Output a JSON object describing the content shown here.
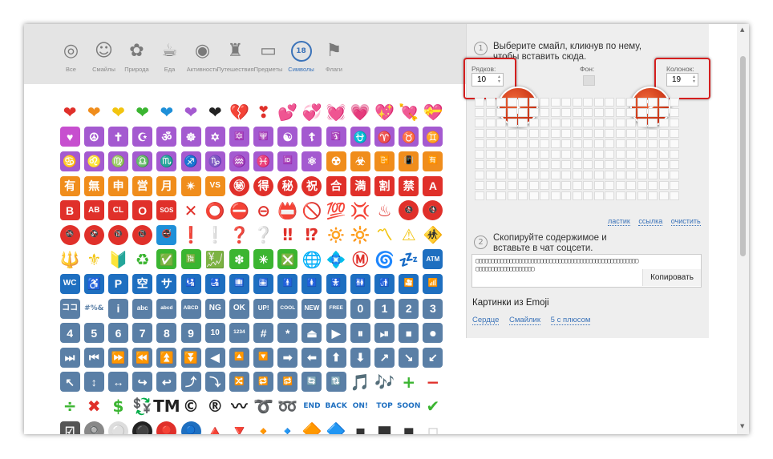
{
  "categories": [
    {
      "label": "Все",
      "icon": "spiral-icon",
      "glyph": "◎"
    },
    {
      "label": "Смайлы",
      "icon": "smiley-icon",
      "glyph": "☺"
    },
    {
      "label": "Природа",
      "icon": "monkey-icon",
      "glyph": "✿"
    },
    {
      "label": "Еда",
      "icon": "food-icon",
      "glyph": "☕"
    },
    {
      "label": "Активность",
      "icon": "target-icon",
      "glyph": "◉"
    },
    {
      "label": "Путешествия",
      "icon": "palace-icon",
      "glyph": "♜"
    },
    {
      "label": "Предметы",
      "icon": "monitor-icon",
      "glyph": "▭"
    },
    {
      "label": "Символы",
      "icon": "symbols-18-icon",
      "glyph": "18"
    },
    {
      "label": "Флаги",
      "icon": "flag-icon",
      "glyph": "⚑"
    }
  ],
  "emoji_grid": [
    {
      "t": "❤",
      "c": "#e0302a",
      "p": 1
    },
    {
      "t": "❤",
      "c": "#f08d1c",
      "p": 1
    },
    {
      "t": "❤",
      "c": "#f2c40f",
      "p": 1
    },
    {
      "t": "❤",
      "c": "#3bb531",
      "p": 1
    },
    {
      "t": "❤",
      "c": "#1e8fd8",
      "p": 1
    },
    {
      "t": "❤",
      "c": "#a45ad0",
      "p": 1
    },
    {
      "t": "❤",
      "c": "#222222",
      "p": 1
    },
    {
      "t": "💔",
      "c": "#d23a3a",
      "p": 1
    },
    {
      "t": "❣",
      "c": "#e0302a",
      "p": 1
    },
    {
      "t": "💕",
      "c": "#e94f9c",
      "p": 1
    },
    {
      "t": "💞",
      "c": "#e94f9c",
      "p": 1
    },
    {
      "t": "💓",
      "c": "#e94f9c",
      "p": 1
    },
    {
      "t": "💗",
      "c": "#e94f9c",
      "p": 1
    },
    {
      "t": "💖",
      "c": "#e94f9c",
      "p": 1
    },
    {
      "t": "💘",
      "c": "#e94f9c",
      "p": 1
    },
    {
      "t": "💝",
      "c": "#e94f9c",
      "p": 1
    },
    {
      "t": "♥",
      "c": "#c74fcf"
    },
    {
      "t": "☮",
      "c": "#a45ad0"
    },
    {
      "t": "✝",
      "c": "#a45ad0"
    },
    {
      "t": "☪",
      "c": "#a45ad0"
    },
    {
      "t": "ॐ",
      "c": "#a45ad0"
    },
    {
      "t": "☸",
      "c": "#a45ad0"
    },
    {
      "t": "✡",
      "c": "#a45ad0"
    },
    {
      "t": "🔯",
      "c": "#a45ad0"
    },
    {
      "t": "🕎",
      "c": "#a45ad0"
    },
    {
      "t": "☯",
      "c": "#a45ad0"
    },
    {
      "t": "☦",
      "c": "#a45ad0"
    },
    {
      "t": "🛐",
      "c": "#a45ad0"
    },
    {
      "t": "⛎",
      "c": "#a45ad0"
    },
    {
      "t": "♈",
      "c": "#a45ad0"
    },
    {
      "t": "♉",
      "c": "#a45ad0"
    },
    {
      "t": "♊",
      "c": "#a45ad0"
    },
    {
      "t": "♋",
      "c": "#a45ad0"
    },
    {
      "t": "♌",
      "c": "#a45ad0"
    },
    {
      "t": "♍",
      "c": "#a45ad0"
    },
    {
      "t": "♎",
      "c": "#a45ad0"
    },
    {
      "t": "♏",
      "c": "#a45ad0"
    },
    {
      "t": "♐",
      "c": "#a45ad0"
    },
    {
      "t": "♑",
      "c": "#a45ad0"
    },
    {
      "t": "♒",
      "c": "#a45ad0"
    },
    {
      "t": "♓",
      "c": "#a45ad0"
    },
    {
      "t": "🆔",
      "c": "#a45ad0"
    },
    {
      "t": "⚛",
      "c": "#a45ad0"
    },
    {
      "t": "☢",
      "c": "#f08d1c"
    },
    {
      "t": "☣",
      "c": "#f08d1c"
    },
    {
      "t": "📴",
      "c": "#f08d1c"
    },
    {
      "t": "📳",
      "c": "#f08d1c"
    },
    {
      "t": "🈶",
      "c": "#f08d1c"
    },
    {
      "t": "有",
      "c": "#f08d1c"
    },
    {
      "t": "無",
      "c": "#f08d1c"
    },
    {
      "t": "申",
      "c": "#f08d1c"
    },
    {
      "t": "営",
      "c": "#f08d1c"
    },
    {
      "t": "月",
      "c": "#f08d1c"
    },
    {
      "t": "✴",
      "c": "#f08d1c"
    },
    {
      "t": "VS",
      "c": "#f08d1c"
    },
    {
      "t": "㊙",
      "c": "#e0302a",
      "r": 1
    },
    {
      "t": "得",
      "c": "#e0302a",
      "r": 1
    },
    {
      "t": "秘",
      "c": "#e0302a",
      "r": 1
    },
    {
      "t": "祝",
      "c": "#e0302a",
      "r": 1
    },
    {
      "t": "合",
      "c": "#e0302a"
    },
    {
      "t": "満",
      "c": "#e0302a"
    },
    {
      "t": "割",
      "c": "#e0302a"
    },
    {
      "t": "禁",
      "c": "#e0302a"
    },
    {
      "t": "A",
      "c": "#e0302a"
    },
    {
      "t": "B",
      "c": "#e0302a"
    },
    {
      "t": "AB",
      "c": "#e0302a"
    },
    {
      "t": "CL",
      "c": "#e0302a"
    },
    {
      "t": "O",
      "c": "#e0302a"
    },
    {
      "t": "SOS",
      "c": "#e0302a"
    },
    {
      "t": "✕",
      "c": "#e0302a",
      "p": 1
    },
    {
      "t": "⭕",
      "c": "#e0302a",
      "p": 1
    },
    {
      "t": "⛔",
      "c": "#e0302a",
      "p": 1
    },
    {
      "t": "⊖",
      "c": "#e0302a",
      "p": 1
    },
    {
      "t": "📛",
      "c": "#e0302a",
      "p": 1
    },
    {
      "t": "🚫",
      "c": "#e0302a",
      "p": 1
    },
    {
      "t": "💯",
      "c": "#e0302a",
      "p": 1
    },
    {
      "t": "💢",
      "c": "#e0302a",
      "p": 1
    },
    {
      "t": "♨",
      "c": "#e0302a",
      "p": 1
    },
    {
      "t": "🚷",
      "c": "#e0302a",
      "r": 1
    },
    {
      "t": "🚯",
      "c": "#e0302a",
      "r": 1
    },
    {
      "t": "🚳",
      "c": "#e0302a",
      "r": 1
    },
    {
      "t": "🚱",
      "c": "#e0302a",
      "r": 1
    },
    {
      "t": "🔞",
      "c": "#e0302a",
      "r": 1
    },
    {
      "t": "📵",
      "c": "#e0302a",
      "r": 1
    },
    {
      "t": "🚭",
      "c": "#1e8fd8"
    },
    {
      "t": "❗",
      "c": "#e0302a",
      "p": 1
    },
    {
      "t": "❕",
      "c": "#bbbbbb",
      "p": 1
    },
    {
      "t": "❓",
      "c": "#e0302a",
      "p": 1
    },
    {
      "t": "❔",
      "c": "#bbbbbb",
      "p": 1
    },
    {
      "t": "‼",
      "c": "#e0302a",
      "p": 1
    },
    {
      "t": "⁉",
      "c": "#e0302a",
      "p": 1
    },
    {
      "t": "🔅",
      "c": "#f2c40f",
      "p": 1
    },
    {
      "t": "🔆",
      "c": "#f2c40f",
      "p": 1
    },
    {
      "t": "〽",
      "c": "#f2c40f",
      "p": 1
    },
    {
      "t": "⚠",
      "c": "#f2c40f",
      "p": 1
    },
    {
      "t": "🚸",
      "c": "#f2c40f",
      "p": 1
    },
    {
      "t": "🔱",
      "c": "#f2c40f",
      "p": 1
    },
    {
      "t": "⚜",
      "c": "#f2c40f",
      "p": 1
    },
    {
      "t": "🔰",
      "c": "#3bb531",
      "p": 1
    },
    {
      "t": "♻",
      "c": "#3bb531",
      "p": 1
    },
    {
      "t": "✅",
      "c": "#3bb531"
    },
    {
      "t": "🈯",
      "c": "#3bb531"
    },
    {
      "t": "💹",
      "c": "#3bb531",
      "p": 1
    },
    {
      "t": "❇",
      "c": "#3bb531"
    },
    {
      "t": "✳",
      "c": "#3bb531"
    },
    {
      "t": "❎",
      "c": "#3bb531"
    },
    {
      "t": "🌐",
      "c": "#1e8fd8",
      "p": 1
    },
    {
      "t": "💠",
      "c": "#1e8fd8",
      "p": 1
    },
    {
      "t": "Ⓜ",
      "c": "#e0302a",
      "p": 1
    },
    {
      "t": "🌀",
      "c": "#1e8fd8",
      "p": 1
    },
    {
      "t": "💤",
      "c": "#1e8fd8",
      "p": 1
    },
    {
      "t": "ATM",
      "c": "#1e6fc0"
    },
    {
      "t": "WC",
      "c": "#1e6fc0"
    },
    {
      "t": "♿",
      "c": "#1e6fc0"
    },
    {
      "t": "P",
      "c": "#1e6fc0"
    },
    {
      "t": "空",
      "c": "#1e6fc0"
    },
    {
      "t": "サ",
      "c": "#1e6fc0"
    },
    {
      "t": "🛂",
      "c": "#1e6fc0"
    },
    {
      "t": "🛃",
      "c": "#1e6fc0"
    },
    {
      "t": "🛄",
      "c": "#1e6fc0"
    },
    {
      "t": "🛅",
      "c": "#1e6fc0"
    },
    {
      "t": "🚹",
      "c": "#1e6fc0"
    },
    {
      "t": "🚺",
      "c": "#1e6fc0"
    },
    {
      "t": "🚼",
      "c": "#1e6fc0"
    },
    {
      "t": "🚻",
      "c": "#1e6fc0"
    },
    {
      "t": "🚮",
      "c": "#1e6fc0"
    },
    {
      "t": "🎦",
      "c": "#1e6fc0"
    },
    {
      "t": "📶",
      "c": "#1e6fc0"
    },
    {
      "t": "ココ",
      "c": "#5a7fa6"
    },
    {
      "t": "#%&",
      "c": "#5a7fa6",
      "p": 1
    },
    {
      "t": "i",
      "c": "#5a7fa6"
    },
    {
      "t": "abc",
      "c": "#5a7fa6"
    },
    {
      "t": "abcd",
      "c": "#5a7fa6"
    },
    {
      "t": "ABCD",
      "c": "#5a7fa6"
    },
    {
      "t": "NG",
      "c": "#5a7fa6"
    },
    {
      "t": "OK",
      "c": "#5a7fa6"
    },
    {
      "t": "UP!",
      "c": "#5a7fa6"
    },
    {
      "t": "COOL",
      "c": "#5a7fa6"
    },
    {
      "t": "NEW",
      "c": "#5a7fa6"
    },
    {
      "t": "FREE",
      "c": "#5a7fa6"
    },
    {
      "t": "0",
      "c": "#5a7fa6"
    },
    {
      "t": "1",
      "c": "#5a7fa6"
    },
    {
      "t": "2",
      "c": "#5a7fa6"
    },
    {
      "t": "3",
      "c": "#5a7fa6"
    },
    {
      "t": "4",
      "c": "#5a7fa6"
    },
    {
      "t": "5",
      "c": "#5a7fa6"
    },
    {
      "t": "6",
      "c": "#5a7fa6"
    },
    {
      "t": "7",
      "c": "#5a7fa6"
    },
    {
      "t": "8",
      "c": "#5a7fa6"
    },
    {
      "t": "9",
      "c": "#5a7fa6"
    },
    {
      "t": "10",
      "c": "#5a7fa6"
    },
    {
      "t": "1234",
      "c": "#5a7fa6"
    },
    {
      "t": "#",
      "c": "#5a7fa6"
    },
    {
      "t": "*",
      "c": "#5a7fa6"
    },
    {
      "t": "⏏",
      "c": "#5a7fa6"
    },
    {
      "t": "▶",
      "c": "#5a7fa6"
    },
    {
      "t": "⏸",
      "c": "#5a7fa6"
    },
    {
      "t": "⏯",
      "c": "#5a7fa6"
    },
    {
      "t": "⏹",
      "c": "#5a7fa6"
    },
    {
      "t": "⏺",
      "c": "#5a7fa6"
    },
    {
      "t": "⏭",
      "c": "#5a7fa6"
    },
    {
      "t": "⏮",
      "c": "#5a7fa6"
    },
    {
      "t": "⏩",
      "c": "#5a7fa6"
    },
    {
      "t": "⏪",
      "c": "#5a7fa6"
    },
    {
      "t": "⏫",
      "c": "#5a7fa6"
    },
    {
      "t": "⏬",
      "c": "#5a7fa6"
    },
    {
      "t": "◀",
      "c": "#5a7fa6"
    },
    {
      "t": "🔼",
      "c": "#5a7fa6"
    },
    {
      "t": "🔽",
      "c": "#5a7fa6"
    },
    {
      "t": "➡",
      "c": "#5a7fa6"
    },
    {
      "t": "⬅",
      "c": "#5a7fa6"
    },
    {
      "t": "⬆",
      "c": "#5a7fa6"
    },
    {
      "t": "⬇",
      "c": "#5a7fa6"
    },
    {
      "t": "↗",
      "c": "#5a7fa6"
    },
    {
      "t": "↘",
      "c": "#5a7fa6"
    },
    {
      "t": "↙",
      "c": "#5a7fa6"
    },
    {
      "t": "↖",
      "c": "#5a7fa6"
    },
    {
      "t": "↕",
      "c": "#5a7fa6"
    },
    {
      "t": "↔",
      "c": "#5a7fa6"
    },
    {
      "t": "↪",
      "c": "#5a7fa6"
    },
    {
      "t": "↩",
      "c": "#5a7fa6"
    },
    {
      "t": "⤴",
      "c": "#5a7fa6"
    },
    {
      "t": "⤵",
      "c": "#5a7fa6"
    },
    {
      "t": "🔀",
      "c": "#5a7fa6"
    },
    {
      "t": "🔁",
      "c": "#5a7fa6"
    },
    {
      "t": "🔂",
      "c": "#5a7fa6"
    },
    {
      "t": "🔄",
      "c": "#5a7fa6"
    },
    {
      "t": "🔃",
      "c": "#5a7fa6"
    },
    {
      "t": "🎵",
      "c": "#a45ad0",
      "p": 1
    },
    {
      "t": "🎶",
      "c": "#e0302a",
      "p": 1
    },
    {
      "t": "+",
      "c": "#3bb531",
      "p": 1
    },
    {
      "t": "−",
      "c": "#e0302a",
      "p": 1
    },
    {
      "t": "÷",
      "c": "#3bb531",
      "p": 1
    },
    {
      "t": "✖",
      "c": "#e0302a",
      "p": 1
    },
    {
      "t": "$",
      "c": "#3bb531",
      "p": 1
    },
    {
      "t": "💱",
      "c": "#3bb531",
      "p": 1
    },
    {
      "t": "TM",
      "c": "#222222",
      "p": 1
    },
    {
      "t": "©",
      "c": "#222222",
      "p": 1
    },
    {
      "t": "®",
      "c": "#222222",
      "p": 1
    },
    {
      "t": "〰",
      "c": "#222222",
      "p": 1
    },
    {
      "t": "➰",
      "c": "#1e8fd8",
      "p": 1
    },
    {
      "t": "➿",
      "c": "#1e8fd8",
      "p": 1
    },
    {
      "t": "END",
      "c": "#1e6fc0",
      "p": 1
    },
    {
      "t": "BACK",
      "c": "#1e6fc0",
      "p": 1
    },
    {
      "t": "ON!",
      "c": "#1e6fc0",
      "p": 1
    },
    {
      "t": "TOP",
      "c": "#1e6fc0",
      "p": 1
    },
    {
      "t": "SOON",
      "c": "#1e6fc0",
      "p": 1
    },
    {
      "t": "✔",
      "c": "#3bb531",
      "p": 1
    },
    {
      "t": "☑",
      "c": "#555555"
    },
    {
      "t": "🔘",
      "c": "#888888",
      "r": 1
    },
    {
      "t": "⚪",
      "c": "#dddddd",
      "r": 1
    },
    {
      "t": "⚫",
      "c": "#222222",
      "r": 1
    },
    {
      "t": "🔴",
      "c": "#e0302a",
      "r": 1
    },
    {
      "t": "🔵",
      "c": "#1e6fc0",
      "r": 1
    },
    {
      "t": "🔺",
      "c": "#e0302a",
      "p": 1
    },
    {
      "t": "🔻",
      "c": "#e0302a",
      "p": 1
    },
    {
      "t": "🔸",
      "c": "#f08d1c",
      "p": 1
    },
    {
      "t": "🔹",
      "c": "#1e8fd8",
      "p": 1
    },
    {
      "t": "🔶",
      "c": "#f08d1c",
      "p": 1
    },
    {
      "t": "🔷",
      "c": "#1e8fd8",
      "p": 1
    },
    {
      "t": "▪",
      "c": "#333333",
      "p": 1
    },
    {
      "t": "■",
      "c": "#333333",
      "p": 1
    },
    {
      "t": "◾",
      "c": "#333333",
      "p": 1
    },
    {
      "t": "◽",
      "c": "#cccccc",
      "p": 1
    }
  ],
  "step1": {
    "num": "1",
    "text": "Выберите смайл, кликнув по нему, чтобы вставить сюда."
  },
  "rows": {
    "label": "Рядков:",
    "value": "10"
  },
  "bg": {
    "label": "Фон:"
  },
  "cols": {
    "label": "Колонок:",
    "value": "19"
  },
  "badges": [
    "1",
    "2"
  ],
  "grid_links": [
    "ластик",
    "ссылка",
    "очистить"
  ],
  "step2": {
    "num": "2",
    "text": "Скопируйте содержимое и вставьте в чат соцсети."
  },
  "output_text": "▢▢▢▢▢▢▢▢▢▢▢▢▢▢▢▢▢▢▢▢▢▢▢▢▢▢▢▢▢▢▢▢▢▢▢▢▢▢▢▢▢▢▢▢▢▢▢▢▢▢▢▢▢▢▢▢▢▢▢▢▢▢▢▢▢▢▢▢▢▢▢▢",
  "copy_label": "Копировать",
  "pictures_title": "Картинки из Emoji",
  "picture_links": [
    "Сердце",
    "Смайлик",
    "5 с плюсом"
  ],
  "colors": {
    "accent": "#3b73b9",
    "highlight": "#d41f1f",
    "badge": "#d9401a"
  }
}
